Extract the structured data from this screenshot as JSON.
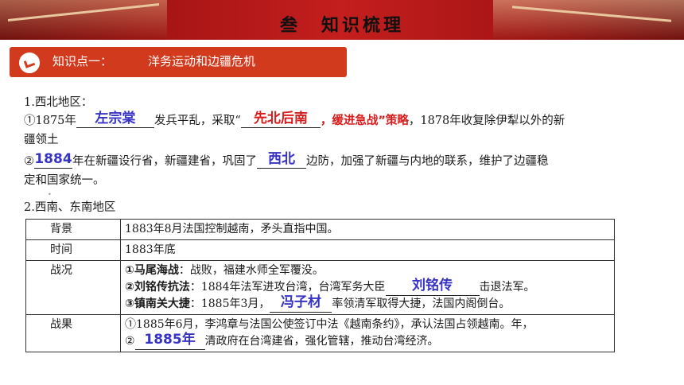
{
  "header": {
    "title": "叁　知识梳理"
  },
  "section": {
    "label": "知识点一：",
    "topic": "洋务运动和边疆危机"
  },
  "northwest": {
    "heading": "1.西北地区：",
    "line1_prefix": "①1875年",
    "answer_person": "左宗棠",
    "line1_mid": "发兵平乱，采取“",
    "answer_strategy": "先北后南",
    "line1_strategy_tail": "，缓进急战”策略",
    "line1_suffix": "，1878年收复除伊犁以外的新",
    "line1_wrap": "疆领土",
    "line2_prefix": "②",
    "answer_year": "1884",
    "line2_mid": "年在新疆设行省，新疆建省，巩固了",
    "answer_region": "西北",
    "line2_suffix": "边防，加强了新疆与内地的联系，维护了边疆稳",
    "line2_wrap": "定和国家统一。"
  },
  "southwest": {
    "heading": "2.西南、东南地区",
    "rows": [
      {
        "label": "背景",
        "text": "1883年8月法国控制越南，矛头直指中国。"
      },
      {
        "label": "时间",
        "text": "1883年底"
      }
    ],
    "battle": {
      "label": "战况",
      "item1_title": "①马尾海战",
      "item1_text": "：战败，福建水师全军覆没。",
      "item2_title": "②刘铭传抗法",
      "item2_text": "：1884年法军进攻台湾，台湾军务大臣",
      "item2_answer": "刘铭传",
      "item2_suffix": "击退法军。",
      "item3_title": "③镇南关大捷",
      "item3_text": "：1885年3月，",
      "item3_answer": "冯子材",
      "item3_suffix": "率领清军取得大捷，法国内阁倒台。"
    },
    "result": {
      "label": "战果",
      "item1": "①1885年6月，李鸿章与法国公使签订中法《越南条约》，承认法国占领越南。年，",
      "item2_prefix": "②",
      "item2_answer": "1885年",
      "item2_suffix": "清政府在台湾建省，强化管辖，推动台湾经济。"
    }
  },
  "colors": {
    "banner": "#c41e1e",
    "heading_bar": "#d23a1e",
    "answer": "#3733c4",
    "emphasis": "#d81c1c"
  }
}
